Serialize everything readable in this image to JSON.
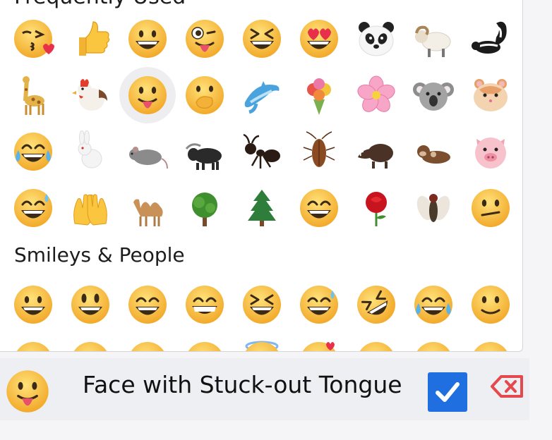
{
  "section_title": "Smileys & People",
  "cut_heading": "Frequently Used",
  "grid_frequent": [
    {
      "name": "kissing-face-with-heart",
      "kind": "kiss"
    },
    {
      "name": "thumbs-up",
      "kind": "thumb"
    },
    {
      "name": "grinning-face",
      "kind": "grin"
    },
    {
      "name": "winking-face-with-tongue",
      "kind": "winktongue"
    },
    {
      "name": "squinting-laughing-face",
      "kind": "squint"
    },
    {
      "name": "heart-eyes-face",
      "kind": "hearteyes"
    },
    {
      "name": "panda",
      "kind": "panda"
    },
    {
      "name": "ram",
      "kind": "sheep"
    },
    {
      "name": "skunk",
      "kind": "skunk"
    },
    {
      "name": "giraffe",
      "kind": "giraffe"
    },
    {
      "name": "rooster",
      "kind": "rooster"
    },
    {
      "name": "face-with-tongue",
      "kind": "tongue",
      "selected": true
    },
    {
      "name": "hand-over-mouth-face",
      "kind": "handmouth"
    },
    {
      "name": "dolphin",
      "kind": "dolphin"
    },
    {
      "name": "bouquet",
      "kind": "bouquet"
    },
    {
      "name": "cherry-blossom",
      "kind": "blossom"
    },
    {
      "name": "koala",
      "kind": "koala"
    },
    {
      "name": "hamster",
      "kind": "hamster"
    },
    {
      "name": "tears-of-joy-face",
      "kind": "tears"
    },
    {
      "name": "rabbit",
      "kind": "rabbit"
    },
    {
      "name": "rat",
      "kind": "rat"
    },
    {
      "name": "water-buffalo",
      "kind": "buffalo"
    },
    {
      "name": "ant",
      "kind": "ant"
    },
    {
      "name": "cockroach",
      "kind": "roach"
    },
    {
      "name": "boar",
      "kind": "boar"
    },
    {
      "name": "otter",
      "kind": "otter"
    },
    {
      "name": "pig-face",
      "kind": "pig"
    },
    {
      "name": "sweat-smile-face",
      "kind": "sweat"
    },
    {
      "name": "raising-hands",
      "kind": "hands"
    },
    {
      "name": "camel",
      "kind": "camel"
    },
    {
      "name": "deciduous-tree",
      "kind": "tree"
    },
    {
      "name": "evergreen-tree",
      "kind": "pine"
    },
    {
      "name": "beaming-face",
      "kind": "beam"
    },
    {
      "name": "rose",
      "kind": "rose"
    },
    {
      "name": "fly",
      "kind": "fly"
    },
    {
      "name": "confused-face",
      "kind": "confused"
    }
  ],
  "grid_smileys": [
    {
      "name": "grinning-face",
      "kind": "grin"
    },
    {
      "name": "grinning-big-eyes-face",
      "kind": "smiley"
    },
    {
      "name": "grinning-smiling-eyes-face",
      "kind": "beam"
    },
    {
      "name": "beaming-face",
      "kind": "beam2"
    },
    {
      "name": "squinting-laughing-face",
      "kind": "squint"
    },
    {
      "name": "sweat-smile-face",
      "kind": "sweat"
    },
    {
      "name": "rolling-laughing-face",
      "kind": "rofl"
    },
    {
      "name": "tears-of-joy-face",
      "kind": "tears"
    },
    {
      "name": "slightly-smiling-face",
      "kind": "slight"
    },
    {
      "name": "face-partial-1",
      "kind": "blank"
    },
    {
      "name": "face-partial-2",
      "kind": "blank"
    },
    {
      "name": "face-partial-3",
      "kind": "blank"
    },
    {
      "name": "face-partial-4",
      "kind": "blank"
    },
    {
      "name": "halo-face-partial",
      "kind": "halo"
    },
    {
      "name": "hearts-face-partial",
      "kind": "hearts"
    },
    {
      "name": "face-partial-5",
      "kind": "blank"
    },
    {
      "name": "face-partial-6",
      "kind": "blank"
    },
    {
      "name": "face-partial-7",
      "kind": "blank"
    }
  ],
  "selected_emoji": {
    "name": "Face with Stuck-out Tongue",
    "kind": "tongue"
  },
  "colors": {
    "accent": "#1f6fe0",
    "delete": "#e5484d",
    "bar": "#eeeff2",
    "selection": "#eeeef0"
  }
}
